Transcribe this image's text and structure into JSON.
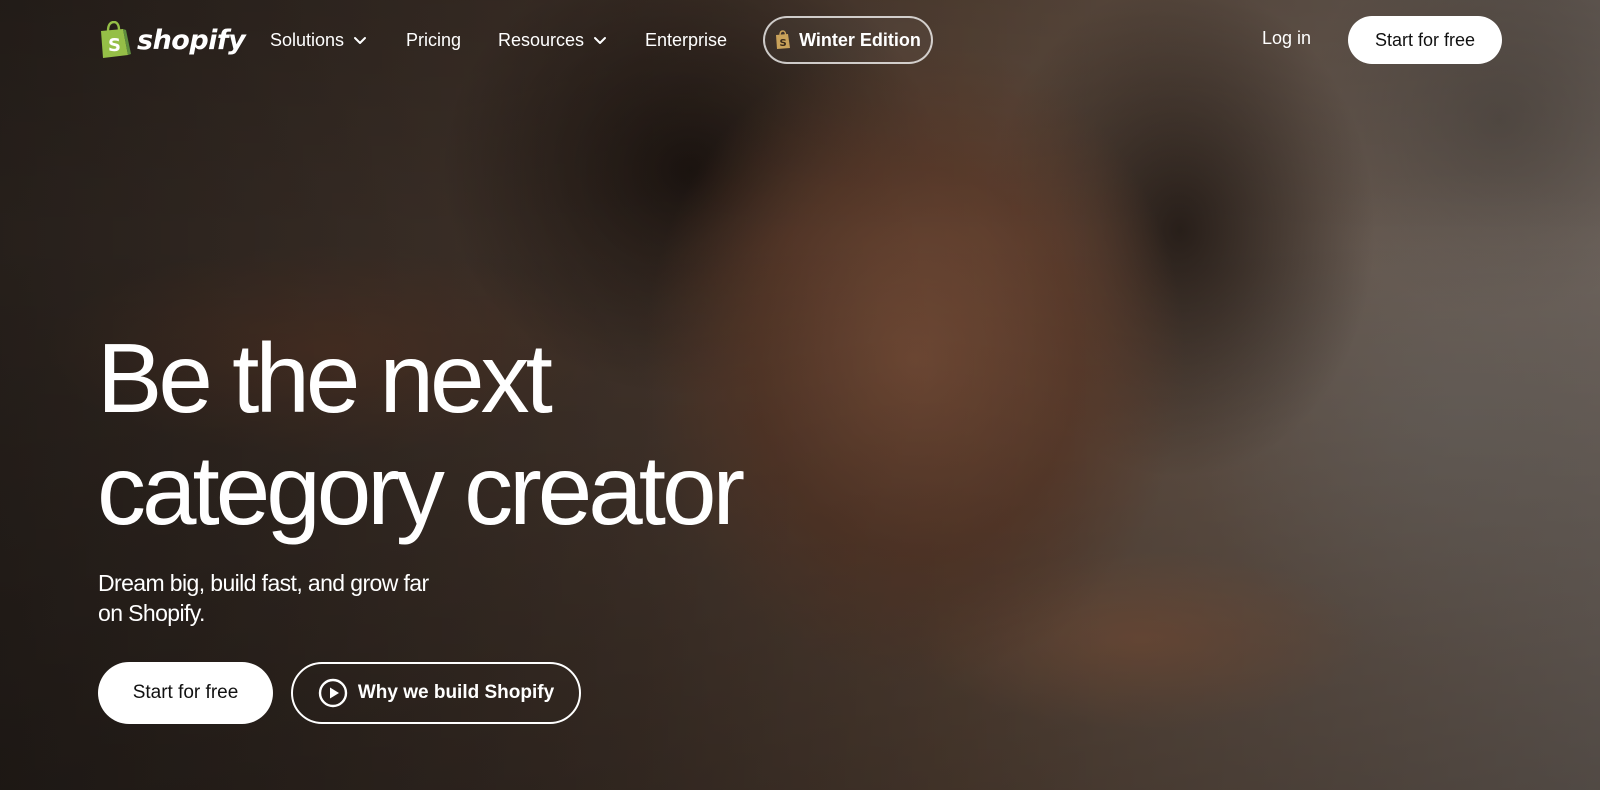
{
  "brand": {
    "name": "shopify",
    "logo_icon": "shopping-bag-icon",
    "logo_green": "#95bf47",
    "logo_dark_green": "#5e8e3e"
  },
  "nav": {
    "items": [
      {
        "label": "Solutions",
        "has_dropdown": true
      },
      {
        "label": "Pricing",
        "has_dropdown": false
      },
      {
        "label": "Resources",
        "has_dropdown": true
      },
      {
        "label": "Enterprise",
        "has_dropdown": false
      }
    ],
    "edition_pill": {
      "label": "Winter Edition",
      "icon": "shopify-bag-icon"
    },
    "login_label": "Log in",
    "cta_label": "Start for free"
  },
  "hero": {
    "headline_line1": "Be the next",
    "headline_line2": "category creator",
    "subheadline": "Dream big, build fast, and grow far on Shopify.",
    "primary_cta": "Start for free",
    "secondary_cta": "Why we build Shopify",
    "secondary_cta_icon": "play-icon"
  },
  "colors": {
    "text": "#ffffff",
    "button_bg": "#ffffff",
    "button_text": "#111111"
  }
}
